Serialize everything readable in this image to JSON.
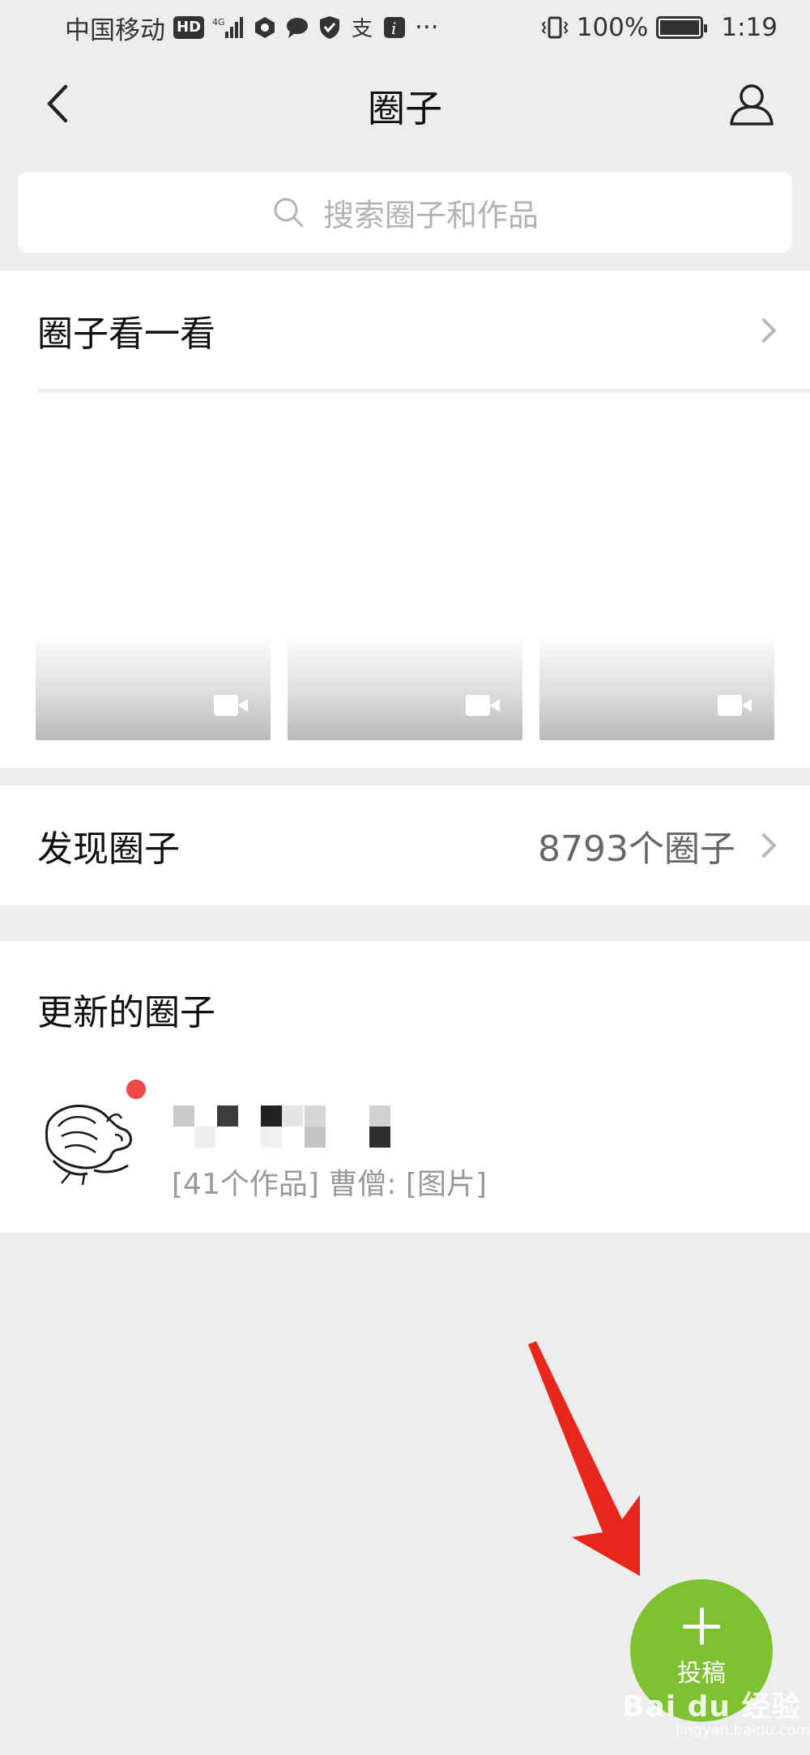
{
  "status_bar": {
    "carrier": "中国移动",
    "hd_badge": "HD",
    "network": "4G",
    "battery_percent": "100%",
    "time": "1:19",
    "more": "···",
    "icons": [
      "hd-icon",
      "signal-icon",
      "app-icon",
      "chat-icon",
      "shield-icon",
      "alipay-icon",
      "info-icon",
      "vibrate-icon",
      "battery-icon"
    ]
  },
  "nav": {
    "title": "圈子",
    "back_icon": "chevron-left-icon",
    "profile_icon": "person-icon"
  },
  "search": {
    "placeholder": "搜索圈子和作品",
    "icon": "search-icon"
  },
  "look_section": {
    "title": "圈子看一看",
    "thumbnails": [
      {
        "type": "video"
      },
      {
        "type": "video"
      },
      {
        "type": "video"
      }
    ]
  },
  "discover": {
    "title": "发现圈子",
    "count": "8793个圈子"
  },
  "updated": {
    "title": "更新的圈子",
    "items": [
      {
        "name": "",
        "description": "[41个作品] 曹僧: [图片]",
        "has_unread": true
      }
    ]
  },
  "fab": {
    "label": "投稿"
  },
  "watermark": {
    "text": "Bai du 经验",
    "sub": "jingyan.baidu.com"
  },
  "colors": {
    "background": "#ededed",
    "fab_green": "#7ec231",
    "unread_red": "#f04848",
    "annotation_red": "#e8261c"
  }
}
